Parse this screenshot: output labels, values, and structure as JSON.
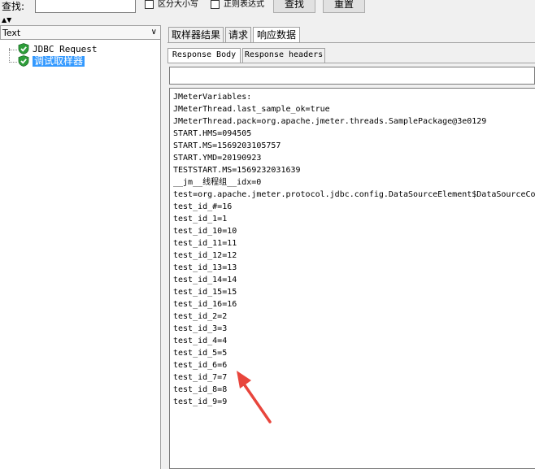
{
  "search": {
    "label": "查找:",
    "value": "",
    "case_sensitive_label": "区分大小写",
    "regex_label": "正则表达式",
    "find_button": "查找",
    "reset_button": "重置"
  },
  "left": {
    "combo_value": "Text",
    "tree": [
      {
        "label": "JDBC Request"
      },
      {
        "label": "调试取样器"
      }
    ]
  },
  "tabs": [
    {
      "label": "取样器结果"
    },
    {
      "label": "请求"
    },
    {
      "label": "响应数据"
    }
  ],
  "subtabs": [
    {
      "label": "Response Body"
    },
    {
      "label": "Response headers"
    }
  ],
  "response_lines": [
    "JMeterVariables:",
    "JMeterThread.last_sample_ok=true",
    "JMeterThread.pack=org.apache.jmeter.threads.SamplePackage@3e0129",
    "START.HMS=094505",
    "START.MS=1569203105757",
    "START.YMD=20190923",
    "TESTSTART.MS=1569232031639",
    "__jm__线程组__idx=0",
    "test=org.apache.jmeter.protocol.jdbc.config.DataSourceElement$DataSourceComponentImpl",
    "test_id_#=16",
    "test_id_1=1",
    "test_id_10=10",
    "test_id_11=11",
    "test_id_12=12",
    "test_id_13=13",
    "test_id_14=14",
    "test_id_15=15",
    "test_id_16=16",
    "test_id_2=2",
    "test_id_3=3",
    "test_id_4=4",
    "test_id_5=5",
    "test_id_6=6",
    "test_id_7=7",
    "test_id_8=8",
    "test_id_9=9"
  ],
  "colors": {
    "selection": "#3399ff",
    "shield_green": "#2e9e3a",
    "arrow_red": "#e8453c"
  }
}
